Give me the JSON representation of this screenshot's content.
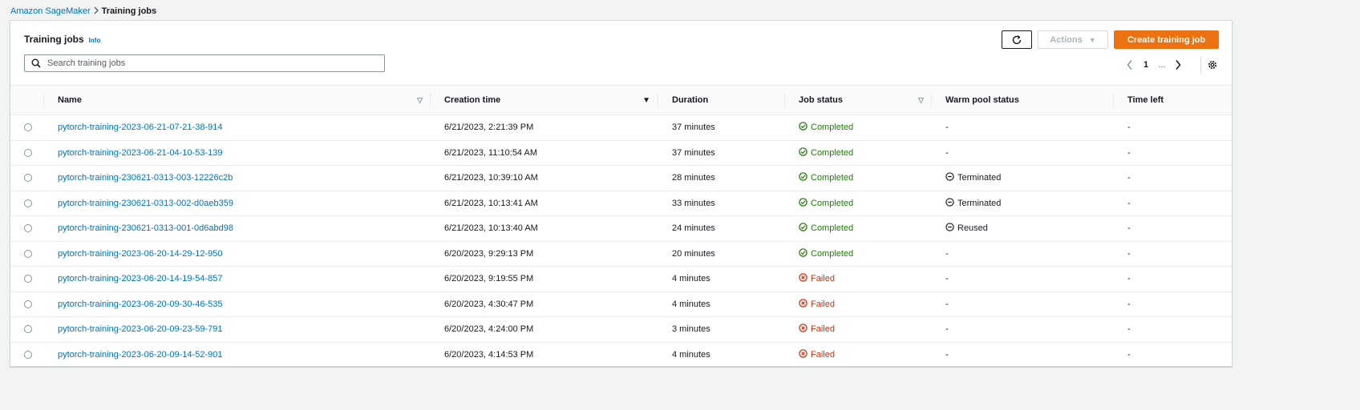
{
  "breadcrumb": {
    "root": "Amazon SageMaker",
    "current": "Training jobs"
  },
  "panel": {
    "title": "Training jobs",
    "info": "Info"
  },
  "toolbar": {
    "actions_label": "Actions",
    "create_label": "Create training job"
  },
  "search": {
    "placeholder": "Search training jobs",
    "value": ""
  },
  "pagination": {
    "current_page": "1",
    "ellipsis": "..."
  },
  "columns": {
    "name": "Name",
    "creation_time": "Creation time",
    "duration": "Duration",
    "job_status": "Job status",
    "warm_pool_status": "Warm pool status",
    "time_left": "Time left"
  },
  "colors": {
    "accent": "#ec7211",
    "link": "#0073bb",
    "success": "#1d8102",
    "error": "#d13212"
  },
  "jobs": [
    {
      "name": "pytorch-training-2023-06-21-07-21-38-914",
      "creation_time": "6/21/2023, 2:21:39 PM",
      "duration": "37 minutes",
      "status": "Completed",
      "status_type": "completed",
      "warm_pool": "-",
      "warm_type": "none",
      "time_left": "-"
    },
    {
      "name": "pytorch-training-2023-06-21-04-10-53-139",
      "creation_time": "6/21/2023, 11:10:54 AM",
      "duration": "37 minutes",
      "status": "Completed",
      "status_type": "completed",
      "warm_pool": "-",
      "warm_type": "none",
      "time_left": "-"
    },
    {
      "name": "pytorch-training-230621-0313-003-12226c2b",
      "creation_time": "6/21/2023, 10:39:10 AM",
      "duration": "28 minutes",
      "status": "Completed",
      "status_type": "completed",
      "warm_pool": "Terminated",
      "warm_type": "stopped",
      "time_left": "-"
    },
    {
      "name": "pytorch-training-230621-0313-002-d0aeb359",
      "creation_time": "6/21/2023, 10:13:41 AM",
      "duration": "33 minutes",
      "status": "Completed",
      "status_type": "completed",
      "warm_pool": "Terminated",
      "warm_type": "stopped",
      "time_left": "-"
    },
    {
      "name": "pytorch-training-230621-0313-001-0d6abd98",
      "creation_time": "6/21/2023, 10:13:40 AM",
      "duration": "24 minutes",
      "status": "Completed",
      "status_type": "completed",
      "warm_pool": "Reused",
      "warm_type": "stopped",
      "time_left": "-"
    },
    {
      "name": "pytorch-training-2023-06-20-14-29-12-950",
      "creation_time": "6/20/2023, 9:29:13 PM",
      "duration": "20 minutes",
      "status": "Completed",
      "status_type": "completed",
      "warm_pool": "-",
      "warm_type": "none",
      "time_left": "-"
    },
    {
      "name": "pytorch-training-2023-06-20-14-19-54-857",
      "creation_time": "6/20/2023, 9:19:55 PM",
      "duration": "4 minutes",
      "status": "Failed",
      "status_type": "failed",
      "warm_pool": "-",
      "warm_type": "none",
      "time_left": "-"
    },
    {
      "name": "pytorch-training-2023-06-20-09-30-46-535",
      "creation_time": "6/20/2023, 4:30:47 PM",
      "duration": "4 minutes",
      "status": "Failed",
      "status_type": "failed",
      "warm_pool": "-",
      "warm_type": "none",
      "time_left": "-"
    },
    {
      "name": "pytorch-training-2023-06-20-09-23-59-791",
      "creation_time": "6/20/2023, 4:24:00 PM",
      "duration": "3 minutes",
      "status": "Failed",
      "status_type": "failed",
      "warm_pool": "-",
      "warm_type": "none",
      "time_left": "-"
    },
    {
      "name": "pytorch-training-2023-06-20-09-14-52-901",
      "creation_time": "6/20/2023, 4:14:53 PM",
      "duration": "4 minutes",
      "status": "Failed",
      "status_type": "failed",
      "warm_pool": "-",
      "warm_type": "none",
      "time_left": "-"
    }
  ]
}
